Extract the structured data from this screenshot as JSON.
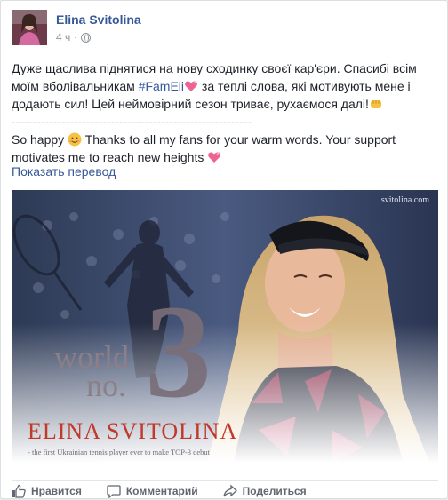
{
  "post": {
    "author": "Elina Svitolina",
    "time": "4 ч",
    "separator": "·",
    "text_uk_1": "Дуже щаслива піднятися на нову сходинку своєї кар'єри. Спасибі всім моїм вболівальникам ",
    "hashtag": "#FamEli",
    "text_uk_2": " за теплі слова, які мотивують мене і додають сил! Цей неймовірний сезон триває, рухаємося далі!",
    "divider": "----------------------------------------------------------",
    "text_en_1": "So happy ",
    "text_en_2": " Thanks to all my fans for your warm words. Your support motivates me to reach new heights ",
    "translate_link": "Показать перевод"
  },
  "photo": {
    "watermark": "svitolina.com",
    "world": "world",
    "no": "no.",
    "rank": "3",
    "name": "ELINA SVITOLINA",
    "caption": "- the first Ukrainian tennis player ever to make TOP-3 debut"
  },
  "actions": {
    "like": "Нравится",
    "comment": "Комментарий",
    "share": "Поделиться"
  },
  "colors": {
    "link": "#365899",
    "text": "#1d2129",
    "meta": "#90949c",
    "heading_red": "#c0392b"
  },
  "icons": [
    "globe-icon",
    "heart-emoji-icon",
    "fist-emoji-icon",
    "smile-emoji-icon",
    "like-icon",
    "comment-icon",
    "share-icon"
  ]
}
